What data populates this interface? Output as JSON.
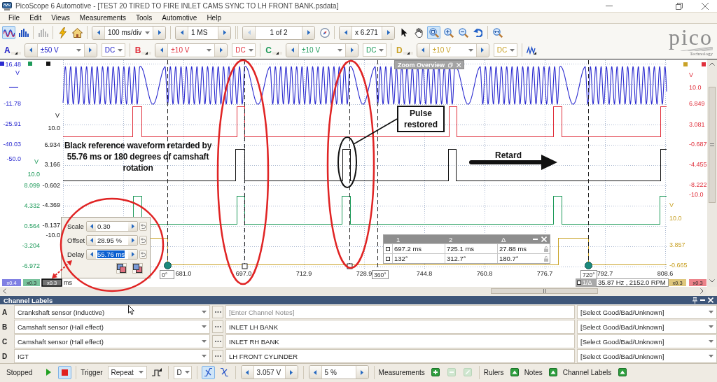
{
  "window": {
    "title": "PicoScope 6 Automotive - [TEST 20 TIRED TO FIRE INLET CAMS SYNC TO LH FRONT BANK.psdata]"
  },
  "menu": [
    "File",
    "Edit",
    "Views",
    "Measurements",
    "Tools",
    "Automotive",
    "Help"
  ],
  "toolbar": {
    "views": [
      {
        "kind": "scope",
        "selected": true,
        "disabled": false
      },
      {
        "kind": "spectrum",
        "selected": false,
        "disabled": false
      },
      {
        "kind": "persistence",
        "selected": false,
        "disabled": true
      }
    ],
    "timebase": "100 ms/div",
    "samples": "1 MS",
    "buffer": {
      "value": "1 of 2",
      "prev_disabled": true
    },
    "zoom_factor": "x 6.271",
    "tools": [
      {
        "kind": "pointer",
        "selected": false
      },
      {
        "kind": "hand",
        "selected": false
      },
      {
        "kind": "zoom-area",
        "selected": true
      },
      {
        "kind": "zoom-in",
        "selected": false
      },
      {
        "kind": "zoom-out",
        "selected": false
      },
      {
        "kind": "undo-zoom",
        "selected": false
      },
      {
        "kind": "zoom-fit",
        "selected": false
      }
    ]
  },
  "channels": [
    {
      "letter": "A",
      "range": "±50 V",
      "coupling": "DC",
      "color": "#2323c8"
    },
    {
      "letter": "B",
      "range": "±10 V",
      "coupling": "DC",
      "color": "#e0303c"
    },
    {
      "letter": "C",
      "range": "±10 V",
      "coupling": "DC",
      "color": "#1e9a5a"
    },
    {
      "letter": "D",
      "range": "±10 V",
      "coupling": "DC",
      "color": "#c9a227"
    }
  ],
  "logo": {
    "wordmark": "pico",
    "tagline": "Technology"
  },
  "scope": {
    "left_axes": [
      {
        "color": "#2b2bd0",
        "unit": "V",
        "labels": [
          "16.48",
          "-11.78",
          "-25.91",
          "-40.03",
          "-50.0"
        ],
        "scale": "x0.4",
        "selected": false
      },
      {
        "color": "#1e9a5a",
        "unit": "V",
        "labels": [
          "10.0",
          "8.099",
          "4.332",
          "0.564",
          "-3.204",
          "-6.972"
        ],
        "scale": "x0.3",
        "selected": false
      },
      {
        "color": "#141414",
        "unit": "V",
        "labels": [
          "10.0",
          "6.934",
          "3.166",
          "-0.602",
          "-4.369",
          "-8.137",
          "-10.0"
        ],
        "scale": "x0.3",
        "selected": true
      }
    ],
    "right_axes": [
      {
        "color": "#c9a227",
        "unit": "V",
        "labels": [
          "10.0",
          "3.857",
          "-0.665"
        ],
        "scale": "x0.3",
        "selected": false
      },
      {
        "color": "#e0303c",
        "unit": "V",
        "labels": [
          "10.0",
          "6.849",
          "3.081",
          "-0.687",
          "-4.455",
          "-8.222",
          "-10.0"
        ],
        "scale": "x0.3",
        "selected": false
      }
    ],
    "traces": [
      {
        "kind": "sine",
        "color": "#2b2bd0"
      },
      {
        "kind": "pulse",
        "color": "#e0303c"
      },
      {
        "kind": "pulse",
        "color": "#141414"
      },
      {
        "kind": "pulse",
        "color": "#1e9a5a"
      },
      {
        "kind": "step",
        "color": "#c9a227"
      }
    ],
    "time_labels": [
      "681.0",
      "697.0",
      "712.9",
      "728.9",
      "744.8",
      "760.8",
      "776.7",
      "792.7",
      "808.6"
    ],
    "time_unit": "ms",
    "rotation_labels": [
      "0°",
      "360°",
      "720°"
    ],
    "readout": {
      "mode": "1/Δ",
      "value": "35.87 Hz , 2152.0 RPM"
    },
    "zoom_overview": {
      "title": "Zoom Overview"
    },
    "scale_popup": [
      {
        "label": "Scale",
        "value": "0.30",
        "selected": false
      },
      {
        "label": "Offset",
        "value": "28.95 %",
        "selected": false
      },
      {
        "label": "Delay",
        "value": "55.76 ms",
        "selected": true
      }
    ],
    "ruler_table": {
      "columns": [
        "1",
        "2",
        "Δ"
      ],
      "rows": [
        [
          "697.2 ms",
          "725.1 ms",
          "27.88 ms"
        ],
        [
          "132°",
          "312.7°",
          "180.7°"
        ]
      ]
    },
    "annotations": {
      "note": "Black reference waveform retarded by 55.76 ms or 180 degrees of camshaft rotation",
      "callout": "Pulse restored",
      "arrow_label": "Retard"
    }
  },
  "channel_labels": {
    "title": "Channel Labels",
    "rows": [
      {
        "letter": "A",
        "probe": "Crankshaft sensor (Inductive)",
        "notes": {
          "placeholder": "[Enter Channel Notes]"
        },
        "rating": "[Select Good/Bad/Unknown]"
      },
      {
        "letter": "B",
        "probe": "Camshaft sensor (Hall effect)",
        "notes": {
          "value": "INLET LH BANK"
        },
        "rating": "[Select Good/Bad/Unknown]"
      },
      {
        "letter": "C",
        "probe": "Camshaft sensor (Hall effect)",
        "notes": {
          "value": "INLET RH BANK"
        },
        "rating": "[Select Good/Bad/Unknown]"
      },
      {
        "letter": "D",
        "probe": "IGT",
        "notes": {
          "value": "LH FRONT CYLINDER"
        },
        "rating": "[Select Good/Bad/Unknown]"
      }
    ]
  },
  "status_bar": {
    "state": "Stopped",
    "running": false,
    "trigger_label": "Trigger",
    "trigger_mode": "Repeat",
    "trigger_source": "D",
    "edges": [
      {
        "kind": "rising",
        "selected": true
      },
      {
        "kind": "falling",
        "selected": false
      }
    ],
    "threshold": "3.057 V",
    "pretrigger": "5 %",
    "measurements_label": "Measurements",
    "measurement_actions": [
      {
        "kind": "add",
        "disabled": false
      },
      {
        "kind": "remove",
        "disabled": true
      },
      {
        "kind": "edit",
        "disabled": true
      }
    ],
    "panels": [
      "Rulers",
      "Notes",
      "Channel Labels"
    ]
  }
}
